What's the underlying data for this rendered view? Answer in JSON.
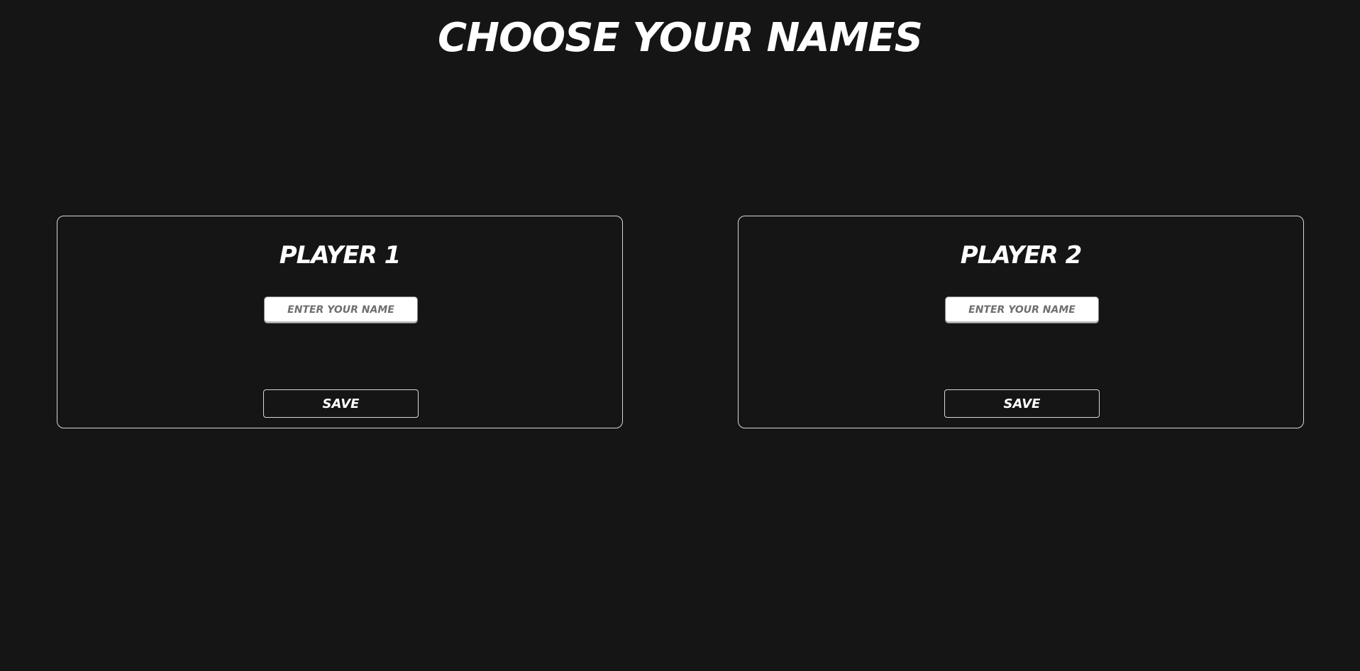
{
  "page": {
    "title": "CHOOSE YOUR NAMES"
  },
  "players": [
    {
      "title": "PLAYER 1",
      "input_placeholder": "ENTER YOUR NAME",
      "input_value": "",
      "save_label": "SAVE"
    },
    {
      "title": "PLAYER 2",
      "input_placeholder": "ENTER YOUR NAME",
      "input_value": "",
      "save_label": "SAVE"
    }
  ],
  "colors": {
    "background": "#151515",
    "text": "#ffffff",
    "border": "#d9d9d9",
    "input_background": "#ffffff",
    "placeholder": "#6f6f6f"
  }
}
